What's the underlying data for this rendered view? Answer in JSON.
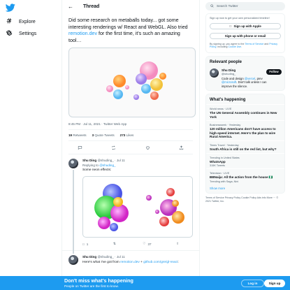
{
  "nav": {
    "logo_icon": "twitter-bird-icon",
    "items": [
      {
        "label": "Explore",
        "icon": "hashtag-icon"
      },
      {
        "label": "Settings",
        "icon": "gear-icon"
      }
    ]
  },
  "header": {
    "title": "Thread"
  },
  "tweet": {
    "text_a": "Did some research on metaballs today... got some interesting renderings w/ React and WebGL. Also tried ",
    "link": "remotion.dev",
    "text_b": " for the first time, it's such an amazing tool…",
    "meta": "8:45 PM · Jul 11, 2021 · Twitter Web App",
    "retweets_count": "19",
    "retweets_label": "Retweets",
    "quotes_count": "3",
    "quotes_label": "Quote Tweets",
    "likes_count": "273",
    "likes_label": "Likes"
  },
  "replies": [
    {
      "name": "Shu Ding",
      "handle": "@shuding_",
      "sep": "·",
      "date": "Jul 11",
      "replying_prefix": "Replying to ",
      "replying_handle": "@shuding_",
      "text": "Some neon effects:",
      "reply_count": "1",
      "retweet_count": "",
      "like_count": "37"
    },
    {
      "name": "Shu Ding",
      "handle": "@shuding_",
      "sep": "·",
      "date": "Jul 11",
      "text_a": "Here's what I've got from ",
      "link_a": "remotion.dev",
      "text_b": " + ",
      "link_b": "github.com/gre/gl-react",
      "text_c": ":"
    }
  ],
  "sidebar": {
    "search_placeholder": "Search Twitter",
    "signup_prompt": "Sign up now to get your own personalized timeline!",
    "apple_button": "Sign up with Apple",
    "phone_button": "Sign up with phone or email",
    "terms_a": "By signing up, you agree to the ",
    "terms_link1": "Terms of Service",
    "terms_b": " and ",
    "terms_link2": "Privacy Policy",
    "terms_c": ", including ",
    "terms_link3": "Cookie Use",
    "terms_d": ".",
    "relevant_title": "Relevant people",
    "person": {
      "name": "Shu Ding",
      "handle": "@shuding_",
      "bio_a": "Code and design ",
      "bio_link1": "@vercel",
      "bio_b": ", prev ",
      "bio_link2": "@microsoft",
      "bio_c": ". Don't talk unless I can improve the silence.",
      "follow_label": "Follow"
    },
    "happening_title": "What's happening",
    "trends": [
      {
        "meta": "World news · LIVE",
        "title": "The UN General Assembly continues in New York",
        "sub": ""
      },
      {
        "meta": "Businessweek · Yesterday",
        "title": "120 million Americans don't have access to high-speed internet. Here's the plan to wire Rural America.",
        "sub": ""
      },
      {
        "meta": "Times Travel · Yesterday",
        "title": "South Africa is still on the red list, but why?",
        "sub": ""
      },
      {
        "meta": "Trending in United States",
        "title": "WhatsApp",
        "sub": "315K Tweets"
      },
      {
        "meta": "Television · LIVE",
        "title": "BBNaija: All the action from the house 🇳🇬",
        "sub": "Trending with Saga, Nini"
      }
    ],
    "show_more": "Show more",
    "footer_links": "Terms of Service   Privacy Policy   Cookie Policy   Ads info   More ···   © 2021 Twitter, Inc."
  },
  "bottom_bar": {
    "headline": "Don't miss what's happening",
    "sub": "People on Twitter are the first to know.",
    "login": "Log in",
    "signup": "Sign up"
  },
  "colors": {
    "accent": "#1d9bf0",
    "text": "#0f1419",
    "muted": "#536471",
    "border": "#cfd9de"
  }
}
